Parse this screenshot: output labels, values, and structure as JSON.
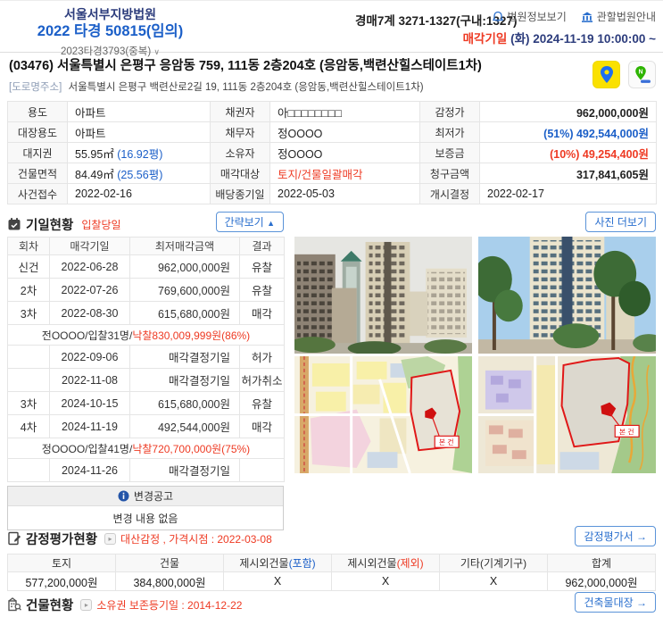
{
  "colors": {
    "navy": "#2c3c7c",
    "blue": "#1b5fc8",
    "red": "#ee3a23",
    "btn_border": "#5a93d8",
    "btn_text": "#2a6fce",
    "label_bg": "#f8f8f8"
  },
  "icons": {
    "chevron_down": "∨",
    "collapse": "▲",
    "arrow": "→",
    "marker": "▸"
  },
  "header": {
    "court": "서울서부지방법원",
    "case_no": "2022 타경 50815(임의)",
    "related_case": "2023타경3793(중복)",
    "dept": "경매7계 3271-1327(구내:1327)",
    "court_info_label": "법원정보보기",
    "court_guide_label": "관할법원안내",
    "sale_date_label": "매각기일",
    "sale_date_value": "(화) 2024-11-19 10:00:00 ~"
  },
  "address": {
    "main": "(03476) 서울특별시 은평구 응암동 759, 111동 2층204호 (응암동,백련산힐스테이트1차)",
    "road_label": "[도로명주소]",
    "road": "서울특별시 은평구 백련산로2길 19, 111동 2층204호 (응암동,백련산힐스테이트1차)"
  },
  "info": {
    "rows": [
      [
        {
          "label": "용도",
          "parts": [
            {
              "t": "아파트"
            }
          ]
        },
        {
          "label": "채권자",
          "parts": [
            {
              "t": "아□□□□□□□□"
            }
          ]
        },
        {
          "label": "감정가",
          "align": "right",
          "parts": [
            {
              "t": "962,000,000원",
              "c": "bold"
            }
          ]
        }
      ],
      [
        {
          "label": "대장용도",
          "parts": [
            {
              "t": "아파트"
            }
          ]
        },
        {
          "label": "채무자",
          "parts": [
            {
              "t": "정OOOO"
            }
          ]
        },
        {
          "label": "최저가",
          "align": "right",
          "parts": [
            {
              "t": "(51%) 492,544,000원",
              "c": "blue bold"
            }
          ]
        }
      ],
      [
        {
          "label": "대지권",
          "parts": [
            {
              "t": "55.95㎡ "
            },
            {
              "t": "(16.92평)",
              "c": "blue"
            }
          ]
        },
        {
          "label": "소유자",
          "parts": [
            {
              "t": "정OOOO"
            }
          ]
        },
        {
          "label": "보증금",
          "align": "right",
          "parts": [
            {
              "t": "(10%) 49,254,400원",
              "c": "red bold"
            }
          ]
        }
      ],
      [
        {
          "label": "건물면적",
          "parts": [
            {
              "t": "84.49㎡ "
            },
            {
              "t": "(25.56평)",
              "c": "blue"
            }
          ]
        },
        {
          "label": "매각대상",
          "parts": [
            {
              "t": "토지/건물일괄매각",
              "c": "red"
            }
          ]
        },
        {
          "label": "청구금액",
          "align": "right",
          "parts": [
            {
              "t": "317,841,605원",
              "c": "bold"
            }
          ]
        }
      ],
      [
        {
          "label": "사건접수",
          "parts": [
            {
              "t": "2022-02-16"
            }
          ]
        },
        {
          "label": "배당종기일",
          "parts": [
            {
              "t": "2022-05-03"
            }
          ]
        },
        {
          "label": "개시결정",
          "parts": [
            {
              "t": "2022-02-17"
            }
          ]
        }
      ]
    ]
  },
  "schedule": {
    "title": "기일현황",
    "badge": "입찰당일",
    "toggle_label": "간략보기",
    "headers": [
      "회차",
      "매각기일",
      "최저매각금액",
      "결과"
    ],
    "rows": [
      {
        "type": "normal",
        "round": "신건",
        "date": "2022-06-28",
        "price": "962,000,000원",
        "result": "유찰",
        "rc": ""
      },
      {
        "type": "normal",
        "round": "2차",
        "date": "2022-07-26",
        "price": "769,600,000원",
        "result": "유찰",
        "rc": ""
      },
      {
        "type": "normal",
        "round": "3차",
        "date": "2022-08-30",
        "price": "615,680,000원",
        "result": "매각",
        "rc": "red"
      },
      {
        "type": "merged",
        "parts": [
          {
            "t": "전OOOO/입찰31명/"
          },
          {
            "t": "낙찰830,009,999원(86%)",
            "c": "red"
          }
        ]
      },
      {
        "type": "normal",
        "round": "",
        "date": "2022-09-06",
        "price": "매각결정기일",
        "result": "허가",
        "rc": "red"
      },
      {
        "type": "normal",
        "round": "",
        "date": "2022-11-08",
        "price": "매각결정기일",
        "result": "허가취소",
        "rc": "red"
      },
      {
        "type": "normal",
        "round": "3차",
        "date": "2024-10-15",
        "price": "615,680,000원",
        "result": "유찰",
        "rc": ""
      },
      {
        "type": "normal",
        "round": "4차",
        "date": "2024-11-19",
        "price": "492,544,000원",
        "result": "매각",
        "rc": "red"
      },
      {
        "type": "merged",
        "parts": [
          {
            "t": "정OOOO/입찰41명/"
          },
          {
            "t": "낙찰720,700,000원(75%)",
            "c": "red"
          }
        ]
      },
      {
        "type": "normal",
        "round": "",
        "date": "2024-11-26",
        "price": "매각결정기일",
        "result": "",
        "rc": ""
      }
    ]
  },
  "notice": {
    "title": "변경공고",
    "content": "변경 내용 없음"
  },
  "photos": {
    "more_label": "사진 더보기",
    "map_label": "본 건",
    "items": [
      "apartment-photo-1",
      "apartment-photo-2",
      "cadastral-map-1",
      "cadastral-map-2"
    ]
  },
  "appraisal": {
    "title": "감정평가현황",
    "annotation": "대산감정 , 가격시점 : 2022-03-08",
    "button_label": "감정평가서",
    "headers": [
      [
        {
          "t": "토지"
        }
      ],
      [
        {
          "t": "건물"
        }
      ],
      [
        {
          "t": "제시외건물"
        },
        {
          "t": "(포함)",
          "c": "blue"
        }
      ],
      [
        {
          "t": "제시외건물"
        },
        {
          "t": "(제외)",
          "c": "red"
        }
      ],
      [
        {
          "t": "기타(기계기구)"
        }
      ],
      [
        {
          "t": "합계"
        }
      ]
    ],
    "values": [
      "577,200,000원",
      "384,800,000원",
      "X",
      "X",
      "X",
      "962,000,000원"
    ]
  },
  "building": {
    "title": "건물현황",
    "annotation": "소유권 보존등기일 : 2014-12-22",
    "button_label": "건축물대장"
  }
}
